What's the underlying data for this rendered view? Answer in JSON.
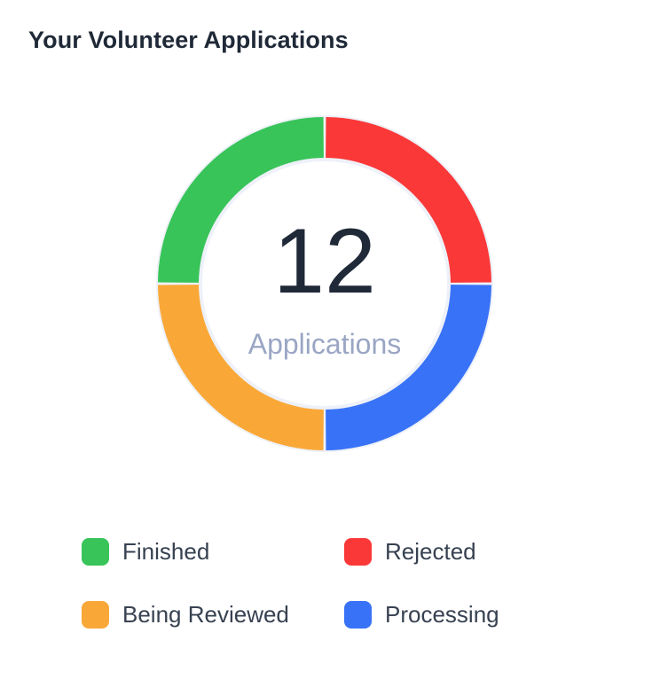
{
  "card": {
    "title": "Your Volunteer Applications"
  },
  "center": {
    "total": "12",
    "label": "Applications"
  },
  "chart_data": {
    "type": "pie",
    "donut": true,
    "categories": [
      "Rejected",
      "Processing",
      "Being Reviewed",
      "Finished"
    ],
    "values": [
      3,
      3,
      3,
      3
    ],
    "colors": [
      "#fa3838",
      "#3872f7",
      "#f9a838",
      "#38c459"
    ],
    "legend_placement": "bottom",
    "legend": [
      {
        "label": "Finished",
        "color": "#38c459"
      },
      {
        "label": "Rejected",
        "color": "#fa3838"
      },
      {
        "label": "Being Reviewed",
        "color": "#f9a838"
      },
      {
        "label": "Processing",
        "color": "#3872f7"
      }
    ]
  }
}
